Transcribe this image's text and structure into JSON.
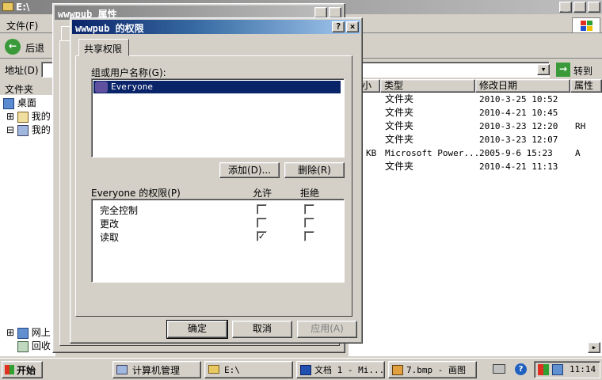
{
  "explorer": {
    "title": "E:\\",
    "menu_file": "文件(F)",
    "back_label": "后退",
    "address_label": "地址(D)",
    "go_label": "转到",
    "folders_label": "文件夹",
    "columns": [
      "大小",
      "类型",
      "修改日期",
      "属性"
    ],
    "rows": [
      {
        "size": "",
        "type": "文件夹",
        "date": "2010-3-25 10:52",
        "attr": ""
      },
      {
        "size": "",
        "type": "文件夹",
        "date": "2010-4-21 10:45",
        "attr": ""
      },
      {
        "size": "",
        "type": "文件夹",
        "date": "2010-3-23 12:20",
        "attr": "RH"
      },
      {
        "size": "",
        "type": "文件夹",
        "date": "2010-3-23 12:07",
        "attr": ""
      },
      {
        "size": "KB",
        "type": "Microsoft Power...",
        "date": "2005-9-6 15:23",
        "attr": "A"
      },
      {
        "size": "",
        "type": "文件夹",
        "date": "2010-4-21 11:13",
        "attr": ""
      }
    ],
    "tree": {
      "desktop": "桌面",
      "my1": "我的",
      "my2": "我的",
      "net": "网上",
      "recycle": "回收"
    }
  },
  "props_dialog": {
    "title": "wwwpub 属性"
  },
  "perm_dialog": {
    "title": "wwwpub 的权限",
    "tab": "共享权限",
    "group_label": "组或用户名称(G):",
    "users": [
      "Everyone"
    ],
    "add_button": "添加(D)...",
    "remove_button": "删除(R)",
    "perm_header": "Everyone 的权限(P)",
    "allow_header": "允许",
    "deny_header": "拒绝",
    "permissions": [
      {
        "name": "完全控制",
        "allow": false,
        "deny": false
      },
      {
        "name": "更改",
        "allow": false,
        "deny": false
      },
      {
        "name": "读取",
        "allow": true,
        "deny": false
      }
    ],
    "ok_button": "确定",
    "cancel_button": "取消",
    "apply_button": "应用(A)"
  },
  "taskbar": {
    "start": "开始",
    "tasks": [
      "计算机管理",
      "E:\\",
      "文档 1 - Mi...",
      "7.bmp - 画图"
    ],
    "clock": "11:14"
  }
}
